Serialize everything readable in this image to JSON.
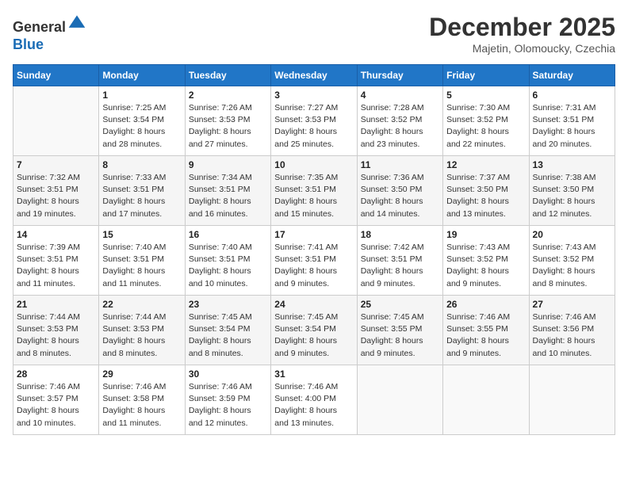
{
  "header": {
    "logo_line1": "General",
    "logo_line2": "Blue",
    "month": "December 2025",
    "location": "Majetin, Olomoucky, Czechia"
  },
  "weekdays": [
    "Sunday",
    "Monday",
    "Tuesday",
    "Wednesday",
    "Thursday",
    "Friday",
    "Saturday"
  ],
  "weeks": [
    [
      {
        "day": "",
        "info": ""
      },
      {
        "day": "1",
        "info": "Sunrise: 7:25 AM\nSunset: 3:54 PM\nDaylight: 8 hours\nand 28 minutes."
      },
      {
        "day": "2",
        "info": "Sunrise: 7:26 AM\nSunset: 3:53 PM\nDaylight: 8 hours\nand 27 minutes."
      },
      {
        "day": "3",
        "info": "Sunrise: 7:27 AM\nSunset: 3:53 PM\nDaylight: 8 hours\nand 25 minutes."
      },
      {
        "day": "4",
        "info": "Sunrise: 7:28 AM\nSunset: 3:52 PM\nDaylight: 8 hours\nand 23 minutes."
      },
      {
        "day": "5",
        "info": "Sunrise: 7:30 AM\nSunset: 3:52 PM\nDaylight: 8 hours\nand 22 minutes."
      },
      {
        "day": "6",
        "info": "Sunrise: 7:31 AM\nSunset: 3:51 PM\nDaylight: 8 hours\nand 20 minutes."
      }
    ],
    [
      {
        "day": "7",
        "info": "Sunrise: 7:32 AM\nSunset: 3:51 PM\nDaylight: 8 hours\nand 19 minutes."
      },
      {
        "day": "8",
        "info": "Sunrise: 7:33 AM\nSunset: 3:51 PM\nDaylight: 8 hours\nand 17 minutes."
      },
      {
        "day": "9",
        "info": "Sunrise: 7:34 AM\nSunset: 3:51 PM\nDaylight: 8 hours\nand 16 minutes."
      },
      {
        "day": "10",
        "info": "Sunrise: 7:35 AM\nSunset: 3:51 PM\nDaylight: 8 hours\nand 15 minutes."
      },
      {
        "day": "11",
        "info": "Sunrise: 7:36 AM\nSunset: 3:50 PM\nDaylight: 8 hours\nand 14 minutes."
      },
      {
        "day": "12",
        "info": "Sunrise: 7:37 AM\nSunset: 3:50 PM\nDaylight: 8 hours\nand 13 minutes."
      },
      {
        "day": "13",
        "info": "Sunrise: 7:38 AM\nSunset: 3:50 PM\nDaylight: 8 hours\nand 12 minutes."
      }
    ],
    [
      {
        "day": "14",
        "info": "Sunrise: 7:39 AM\nSunset: 3:51 PM\nDaylight: 8 hours\nand 11 minutes."
      },
      {
        "day": "15",
        "info": "Sunrise: 7:40 AM\nSunset: 3:51 PM\nDaylight: 8 hours\nand 11 minutes."
      },
      {
        "day": "16",
        "info": "Sunrise: 7:40 AM\nSunset: 3:51 PM\nDaylight: 8 hours\nand 10 minutes."
      },
      {
        "day": "17",
        "info": "Sunrise: 7:41 AM\nSunset: 3:51 PM\nDaylight: 8 hours\nand 9 minutes."
      },
      {
        "day": "18",
        "info": "Sunrise: 7:42 AM\nSunset: 3:51 PM\nDaylight: 8 hours\nand 9 minutes."
      },
      {
        "day": "19",
        "info": "Sunrise: 7:43 AM\nSunset: 3:52 PM\nDaylight: 8 hours\nand 9 minutes."
      },
      {
        "day": "20",
        "info": "Sunrise: 7:43 AM\nSunset: 3:52 PM\nDaylight: 8 hours\nand 8 minutes."
      }
    ],
    [
      {
        "day": "21",
        "info": "Sunrise: 7:44 AM\nSunset: 3:53 PM\nDaylight: 8 hours\nand 8 minutes."
      },
      {
        "day": "22",
        "info": "Sunrise: 7:44 AM\nSunset: 3:53 PM\nDaylight: 8 hours\nand 8 minutes."
      },
      {
        "day": "23",
        "info": "Sunrise: 7:45 AM\nSunset: 3:54 PM\nDaylight: 8 hours\nand 8 minutes."
      },
      {
        "day": "24",
        "info": "Sunrise: 7:45 AM\nSunset: 3:54 PM\nDaylight: 8 hours\nand 9 minutes."
      },
      {
        "day": "25",
        "info": "Sunrise: 7:45 AM\nSunset: 3:55 PM\nDaylight: 8 hours\nand 9 minutes."
      },
      {
        "day": "26",
        "info": "Sunrise: 7:46 AM\nSunset: 3:55 PM\nDaylight: 8 hours\nand 9 minutes."
      },
      {
        "day": "27",
        "info": "Sunrise: 7:46 AM\nSunset: 3:56 PM\nDaylight: 8 hours\nand 10 minutes."
      }
    ],
    [
      {
        "day": "28",
        "info": "Sunrise: 7:46 AM\nSunset: 3:57 PM\nDaylight: 8 hours\nand 10 minutes."
      },
      {
        "day": "29",
        "info": "Sunrise: 7:46 AM\nSunset: 3:58 PM\nDaylight: 8 hours\nand 11 minutes."
      },
      {
        "day": "30",
        "info": "Sunrise: 7:46 AM\nSunset: 3:59 PM\nDaylight: 8 hours\nand 12 minutes."
      },
      {
        "day": "31",
        "info": "Sunrise: 7:46 AM\nSunset: 4:00 PM\nDaylight: 8 hours\nand 13 minutes."
      },
      {
        "day": "",
        "info": ""
      },
      {
        "day": "",
        "info": ""
      },
      {
        "day": "",
        "info": ""
      }
    ]
  ]
}
